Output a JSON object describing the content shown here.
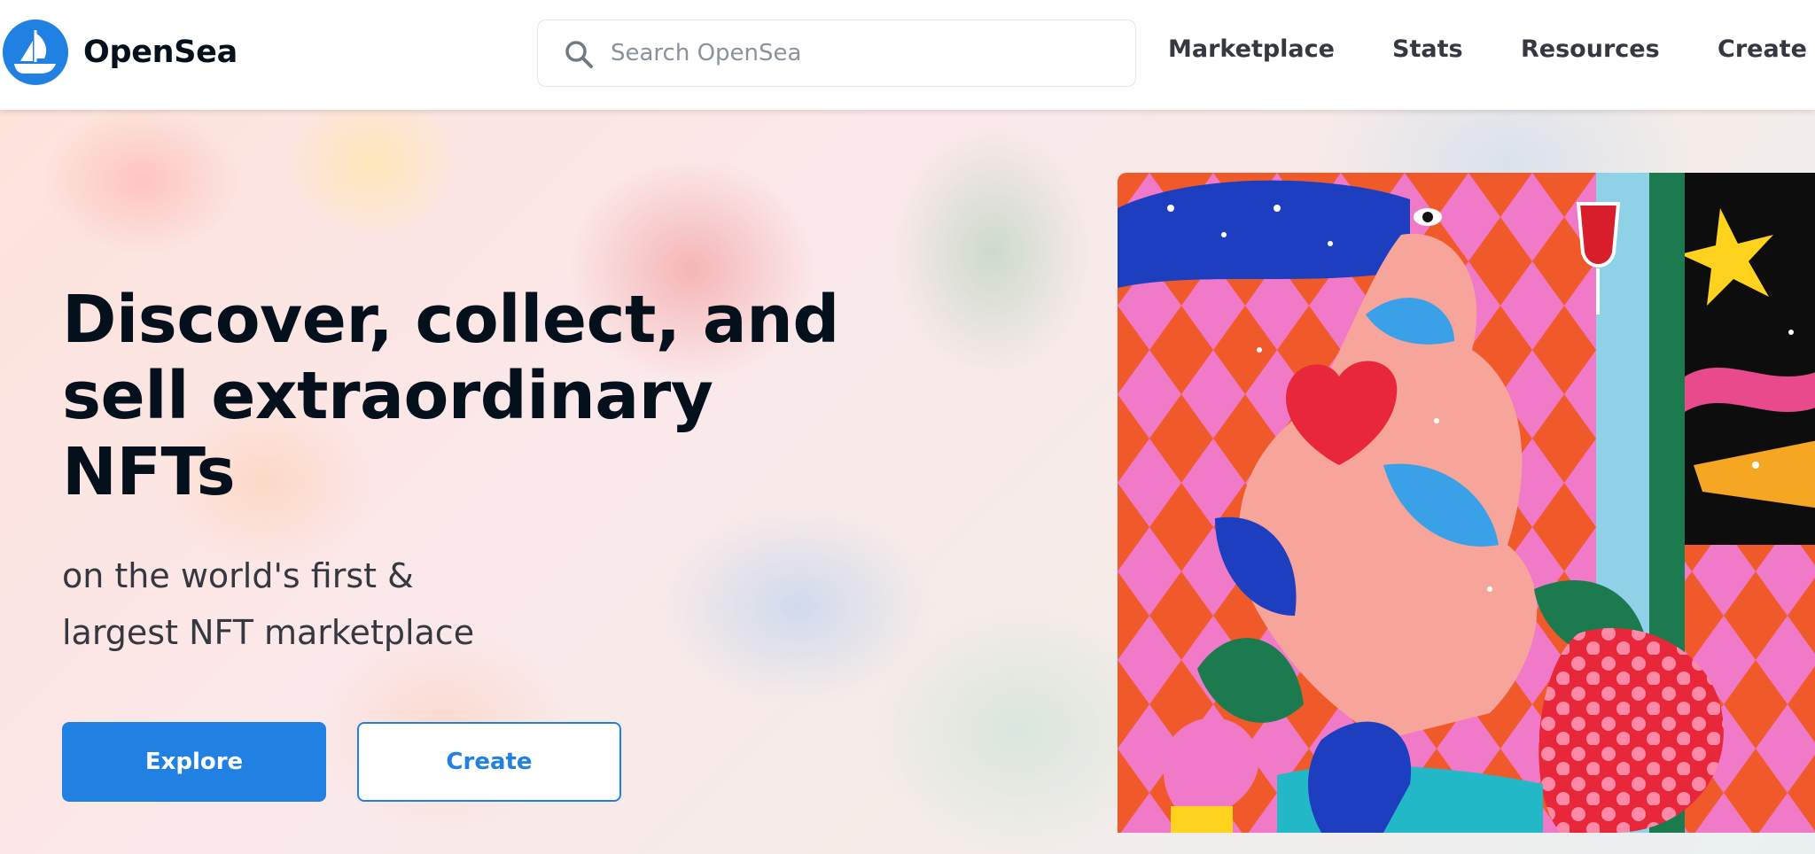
{
  "header": {
    "brand": "OpenSea",
    "search_placeholder": "Search OpenSea",
    "nav": [
      "Marketplace",
      "Stats",
      "Resources",
      "Create"
    ]
  },
  "hero": {
    "headline_line1": "Discover, collect, and",
    "headline_line2": "sell extraordinary",
    "headline_line3": "NFTs",
    "sub_line1": "on the world's first &",
    "sub_line2": "largest NFT marketplace",
    "explore_label": "Explore",
    "create_label": "Create"
  },
  "colors": {
    "brand_blue": "#2081e2",
    "text_dark": "#04111d",
    "text_gray": "#353840"
  },
  "icons": [
    "opensea-logo-icon",
    "search-icon"
  ]
}
